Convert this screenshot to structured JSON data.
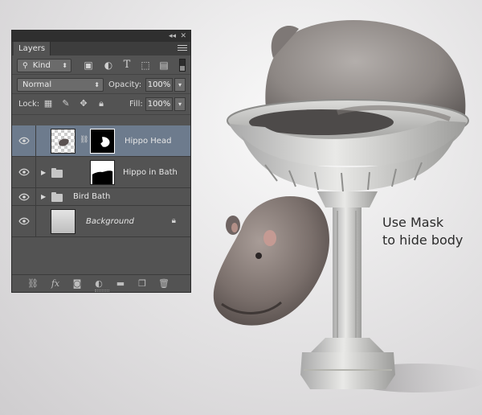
{
  "annotation": {
    "line1": "Use Mask",
    "line2": "to hide body"
  },
  "panel": {
    "tab": "Layers",
    "filter": {
      "kind_label": "Kind",
      "icons": [
        "search-icon",
        "image-filter-icon",
        "adjustment-filter-icon",
        "type-filter-icon",
        "shape-filter-icon",
        "smart-object-filter-icon"
      ]
    },
    "blend_mode": "Normal",
    "opacity_label": "Opacity:",
    "opacity_value": "100%",
    "lock_label": "Lock:",
    "fill_label": "Fill:",
    "fill_value": "100%",
    "layers": [
      {
        "name": "Hippo Head",
        "selected": true,
        "has_mask": true
      },
      {
        "name": "Hippo in Bath",
        "type": "group",
        "has_mask": true
      },
      {
        "name": "Bird Bath",
        "type": "group"
      },
      {
        "name": "Background",
        "locked": true
      }
    ],
    "footer_icons": [
      "link-layers-icon",
      "fx-icon",
      "add-mask-icon",
      "adjustment-layer-icon",
      "new-group-icon",
      "new-layer-icon",
      "trash-icon"
    ],
    "fx_label": "fx"
  },
  "colors": {
    "panel_bg": "#535353",
    "selected_row": "#6d7b8d",
    "canvas_bg": "#e6e5e6"
  }
}
